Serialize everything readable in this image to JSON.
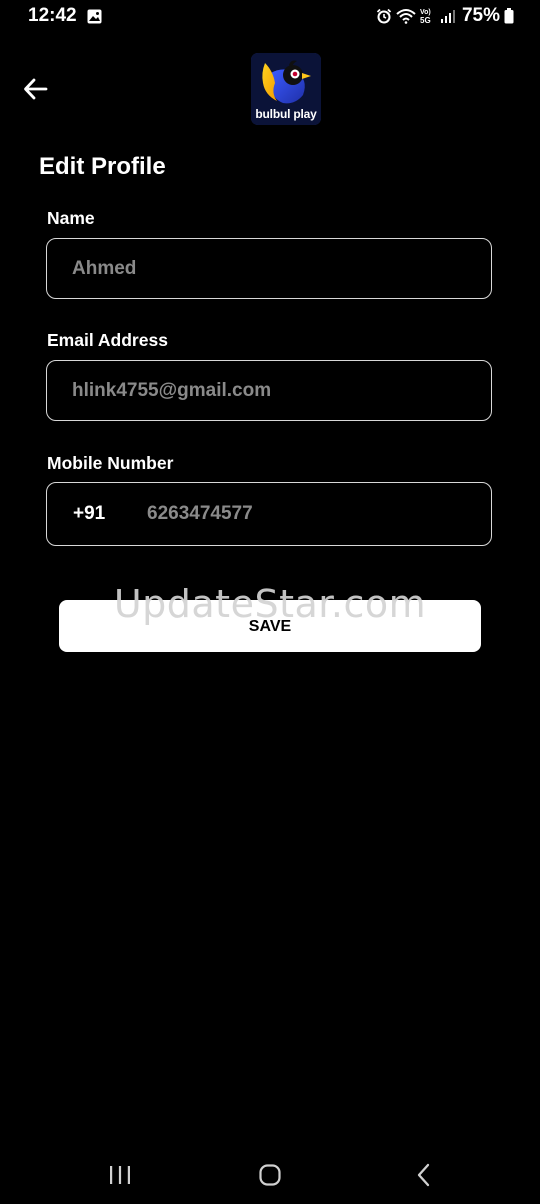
{
  "status_bar": {
    "time": "12:42",
    "battery": "75%",
    "icons": [
      "gallery-icon",
      "alarm-icon",
      "wifi-icon",
      "volte-5g-icon",
      "signal-icon",
      "battery-icon"
    ]
  },
  "header": {
    "back_icon": "arrow-left-icon",
    "logo_text": "bulbul play"
  },
  "page": {
    "title": "Edit Profile"
  },
  "form": {
    "name": {
      "label": "Name",
      "value": "Ahmed"
    },
    "email": {
      "label": "Email Address",
      "value": "hlink4755@gmail.com"
    },
    "mobile": {
      "label": "Mobile Number",
      "country_code": "+91",
      "value": "6263474577"
    }
  },
  "actions": {
    "save_label": "SAVE"
  },
  "watermark": "UpdateStar.com",
  "nav_bar": {
    "icons": [
      "recent-apps-icon",
      "home-icon",
      "back-nav-icon"
    ]
  },
  "colors": {
    "background": "#000000",
    "field_border": "#d8d8d8",
    "placeholder_text": "#8a8a8a",
    "button_bg": "#ffffff",
    "logo_bg": "#0b1338"
  }
}
